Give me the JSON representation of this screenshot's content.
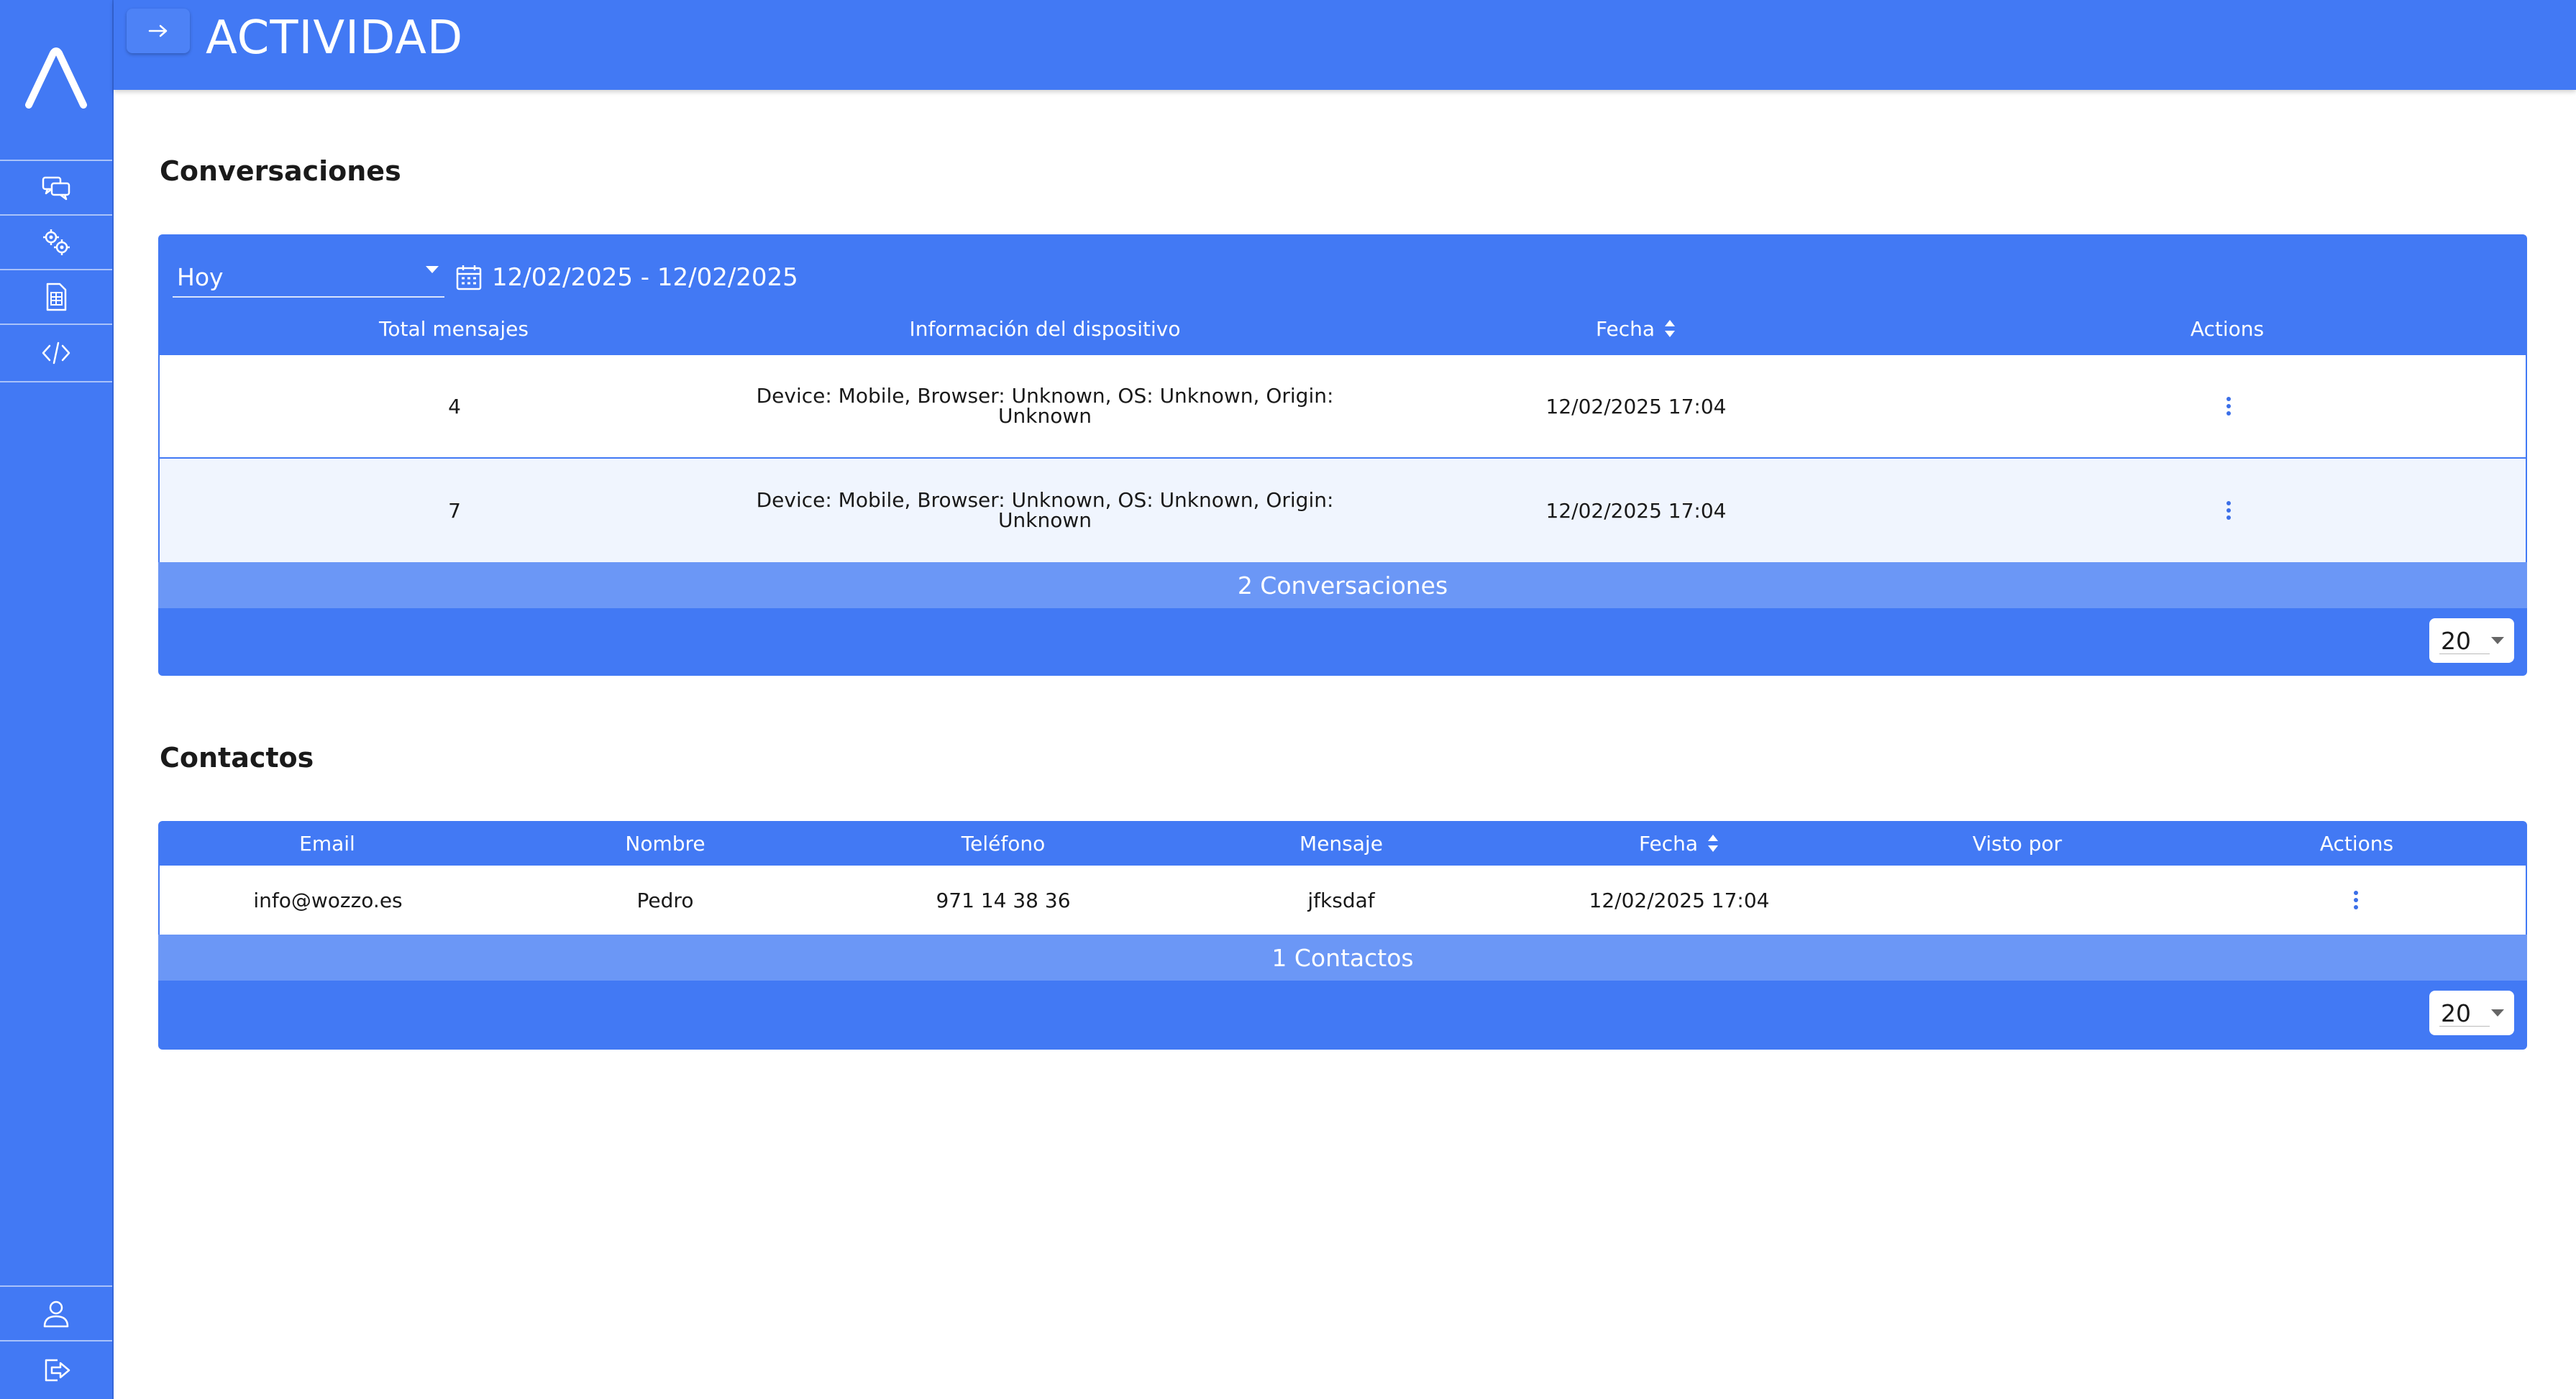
{
  "header": {
    "title": "ACTIVIDAD"
  },
  "sidebar": {
    "logo": "logo-lambda",
    "items": [
      {
        "name": "chat-icon"
      },
      {
        "name": "settings-icon"
      },
      {
        "name": "document-icon"
      },
      {
        "name": "code-icon"
      }
    ],
    "bottom_items": [
      {
        "name": "user-icon"
      },
      {
        "name": "logout-icon"
      }
    ]
  },
  "conversations": {
    "title": "Conversaciones",
    "filter": {
      "selected": "Hoy",
      "date_range": "12/02/2025 - 12/02/2025"
    },
    "columns": [
      "Total mensajes",
      "Información del dispositivo",
      "Fecha",
      "Actions"
    ],
    "rows": [
      {
        "total": "4",
        "device_line1": "Device: Mobile, Browser: Unknown, OS: Unknown, Origin:",
        "device_line2": "Unknown",
        "date": "12/02/2025 17:04"
      },
      {
        "total": "7",
        "device_line1": "Device: Mobile, Browser: Unknown, OS: Unknown, Origin:",
        "device_line2": "Unknown",
        "date": "12/02/2025 17:04"
      }
    ],
    "summary": "2 Conversaciones",
    "page_size": "20"
  },
  "contacts": {
    "title": "Contactos",
    "columns": [
      "Email",
      "Nombre",
      "Teléfono",
      "Mensaje",
      "Fecha",
      "Visto por",
      "Actions"
    ],
    "rows": [
      {
        "email": "info@wozzo.es",
        "name": "Pedro",
        "phone": "971 14 38 36",
        "message": "jfksdaf",
        "date": "12/02/2025 17:04",
        "seen_by": ""
      }
    ],
    "summary": "1 Contactos",
    "page_size": "20"
  },
  "colors": {
    "primary": "#4279f4",
    "summary_bar": "#6b97f6",
    "row_alt": "#f0f5fe"
  }
}
